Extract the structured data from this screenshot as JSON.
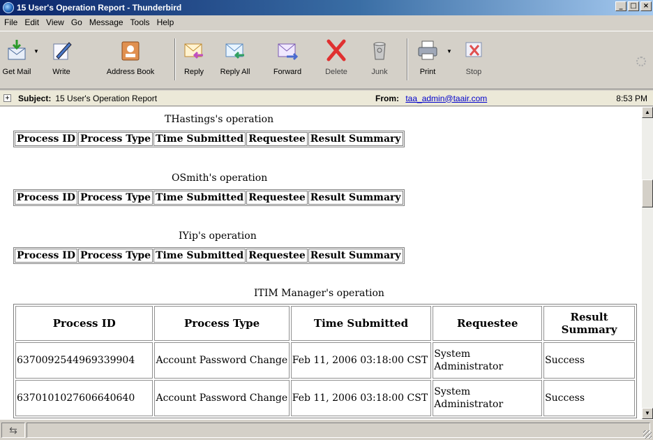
{
  "window": {
    "title": "15 User's Operation Report - Thunderbird",
    "controls": [
      "_",
      "□",
      "×"
    ]
  },
  "menu": [
    "File",
    "Edit",
    "View",
    "Go",
    "Message",
    "Tools",
    "Help"
  ],
  "toolbar": {
    "get_mail": "Get Mail",
    "write": "Write",
    "address_book": "Address Book",
    "reply": "Reply",
    "reply_all": "Reply All",
    "forward": "Forward",
    "delete": "Delete",
    "junk": "Junk",
    "print": "Print",
    "stop": "Stop"
  },
  "header": {
    "expand": "+",
    "subject_label": "Subject:",
    "subject": "15 User's Operation Report",
    "from_label": "From:",
    "from": "taa_admin@taair.com",
    "time": "8:53 PM"
  },
  "columns": [
    "Process ID",
    "Process Type",
    "Time Submitted",
    "Requestee",
    "Result Summary"
  ],
  "operations": [
    {
      "caption": "THastings's operation"
    },
    {
      "caption": "OSmith's operation"
    },
    {
      "caption": "IYip's operation"
    }
  ],
  "manager": {
    "caption": "ITIM Manager's operation",
    "rows": [
      {
        "id": "6370092544969339904",
        "type": "Account Password Change",
        "time": "Feb 11, 2006 03:18:00 CST",
        "requestee": "System Administrator",
        "result": "Success"
      },
      {
        "id": "6370101027606640640",
        "type": "Account Password Change",
        "time": "Feb 11, 2006 03:18:00 CST",
        "requestee": "System Administrator",
        "result": "Success"
      }
    ]
  },
  "status": {
    "icon": "offline-icon"
  }
}
